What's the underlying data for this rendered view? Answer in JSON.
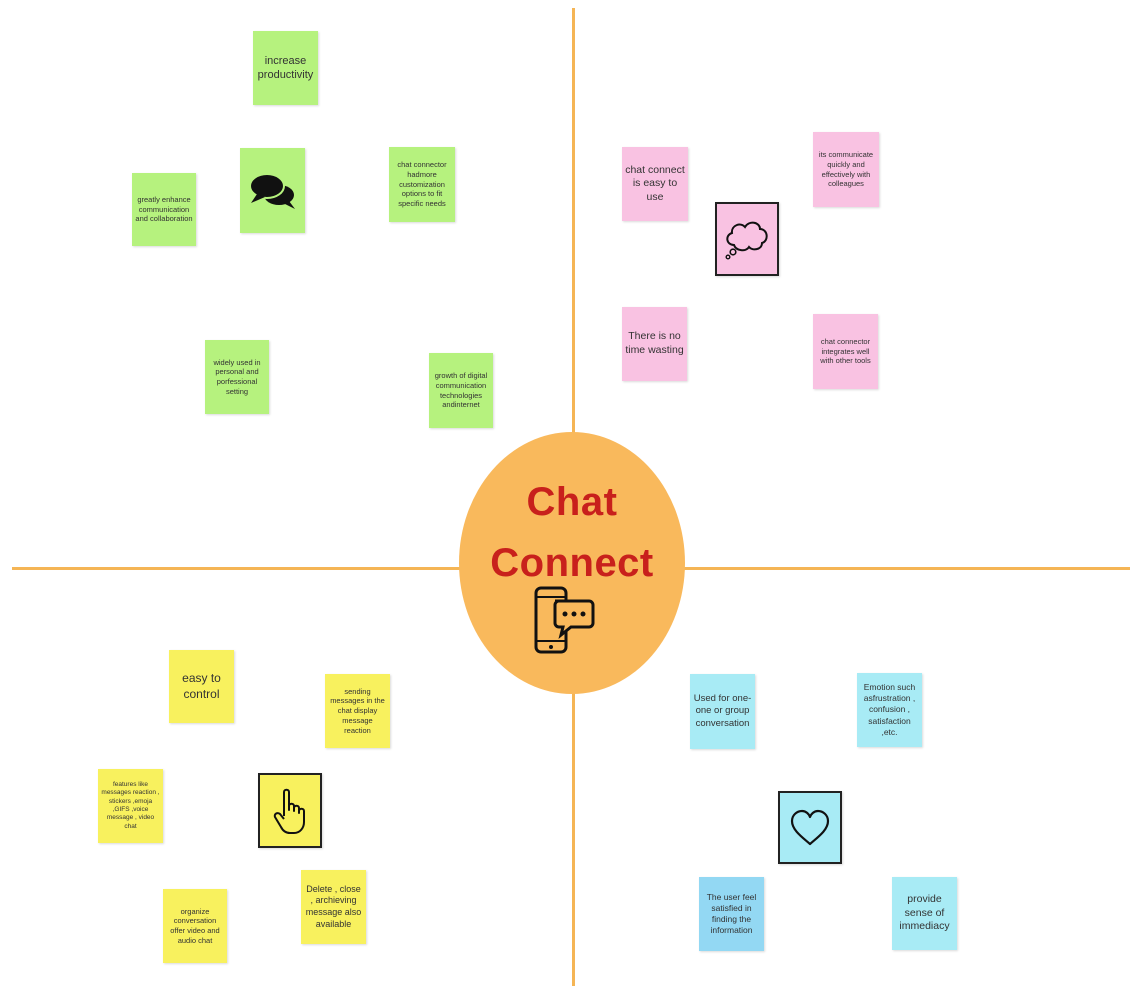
{
  "title": {
    "line1": "Chat",
    "line2": "Connect"
  },
  "colors": {
    "axis": "#f5b555",
    "center": "#f9b95c",
    "title": "#c8201c",
    "green": "#b6f27e",
    "pink": "#f9c2e2",
    "yellow": "#f8f15e",
    "cyan": "#a8ebf5",
    "blue": "#93d8f3"
  },
  "icons": {
    "top_left": "speech-bubbles-icon",
    "top_right": "thought-cloud-icon",
    "bottom_left": "pointing-hand-icon",
    "bottom_right": "heart-icon",
    "center": "phone-chat-icon"
  },
  "quadrants": {
    "top_left": {
      "notes": [
        "increase productivity",
        "greatly enhance communication and collaboration",
        "chat connector hadmore customization options to fit specific needs",
        "widely used in personal and porfessional setting",
        "growth of digital communication technologies andinternet"
      ]
    },
    "top_right": {
      "notes": [
        "chat connect is easy to use",
        "its communicate quickly and effectively with colleagues",
        "There is no time wasting",
        "chat connector integrates well with other tools"
      ]
    },
    "bottom_left": {
      "notes": [
        "easy to control",
        "sending messages in the chat display message reaction",
        "features like messages reaction , stickers ,emoja ,GIFS ,voice message , video chat",
        "organize conversation offer video and audio chat",
        "Delete , close , archieving message also available"
      ]
    },
    "bottom_right": {
      "notes": [
        "Used for one-one or group conversation",
        "Emotion such asfrustration , confusion , satisfaction ,etc.",
        "The user feel satisfied in finding the information",
        "provide sense of immediacy"
      ]
    }
  }
}
